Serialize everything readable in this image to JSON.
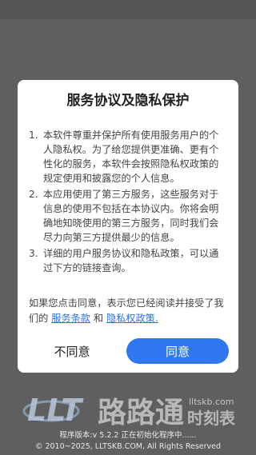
{
  "dialog": {
    "title": "服务协议及隐私保护",
    "terms": [
      {
        "num": "1.",
        "text": "本软件尊重并保护所有使用服务用户的个人隐私权。为了给您提供更准确、更有个性化的服务，本软件会按照隐私权政策的规定使用和披露您的个人信息。"
      },
      {
        "num": "2.",
        "text": "本应用使用了第三方服务，这些服务对于信息的使用不包括在本协议内。你将会明确地知晓使用的第三方服务，同时我们会尽力向第三方提供最少的信息。"
      },
      {
        "num": "3.",
        "text": "详细的用户服务协议和隐私政策，可以通过下方的链接查询。"
      }
    ],
    "agree_prefix": "如果您点击同意，表示您已经阅读并接受了我们的 ",
    "service_link": "服务条款",
    "and_text": " 和 ",
    "privacy_link": "隐私权政策.",
    "disagree_label": "不同意",
    "agree_label": "同意"
  },
  "logo": {
    "letters": "LLT",
    "brand": "路路通",
    "site": "lltskb.com",
    "suffix": "时刻表"
  },
  "footer": {
    "version_line": "程序版本:v 5.2.2  正在初始化程序中......",
    "copyright": "© 2010~2025, LLTSKB.COM, All Rights Reserved"
  }
}
